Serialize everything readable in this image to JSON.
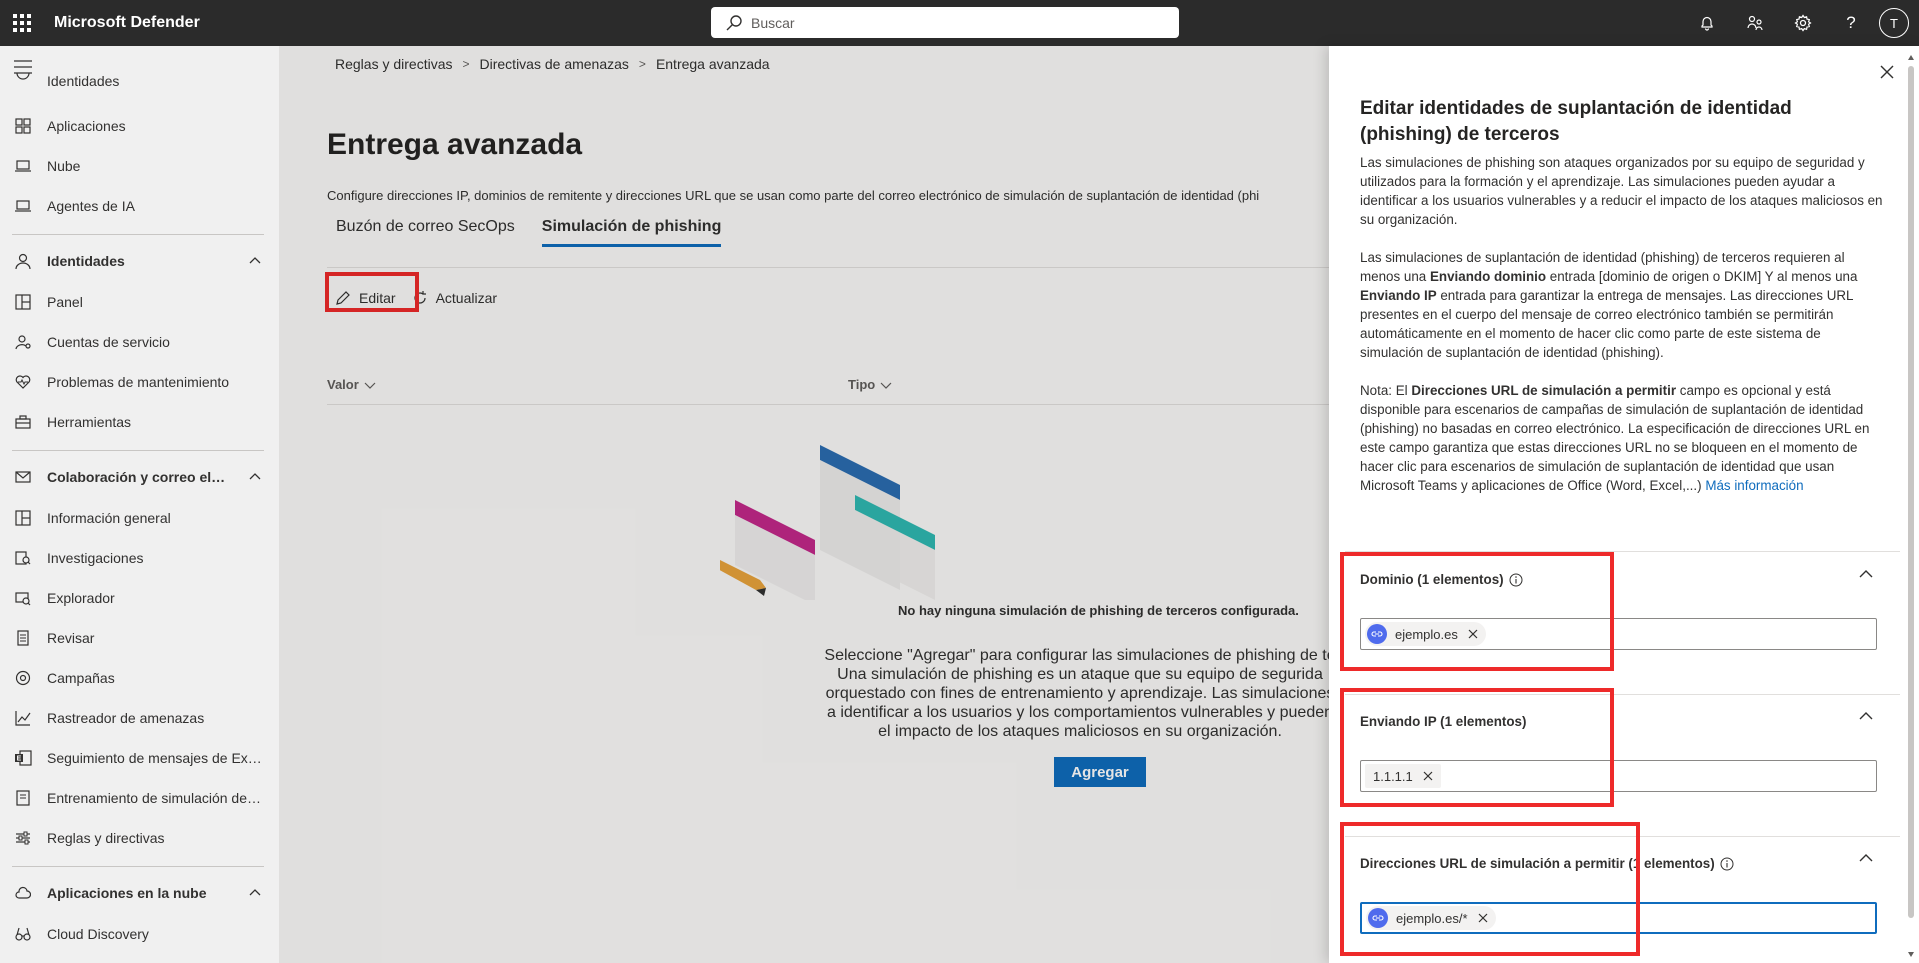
{
  "app": {
    "title": "Microsoft Defender",
    "search_placeholder": "Buscar",
    "avatar_initial": "T"
  },
  "sidebar": {
    "items": [
      {
        "label": "Identidades",
        "icon": "users-icon",
        "partial": true
      },
      {
        "label": "Aplicaciones",
        "icon": "apps-icon"
      },
      {
        "label": "Nube",
        "icon": "cloud-monitor-icon"
      },
      {
        "label": "Agentes de IA",
        "icon": "laptop-icon"
      },
      {
        "label": "Identidades",
        "icon": "person-icon",
        "section": true
      },
      {
        "label": "Panel",
        "icon": "dashboard-icon"
      },
      {
        "label": "Cuentas de servicio",
        "icon": "service-account-icon"
      },
      {
        "label": "Problemas de mantenimiento",
        "icon": "heart-pulse-icon"
      },
      {
        "label": "Herramientas",
        "icon": "toolbox-icon"
      },
      {
        "label": "Colaboración y correo electrónico",
        "icon": "mail-icon",
        "section": true
      },
      {
        "label": "Información general",
        "icon": "grid-icon"
      },
      {
        "label": "Investigaciones",
        "icon": "investigation-icon"
      },
      {
        "label": "Explorador",
        "icon": "explorer-icon"
      },
      {
        "label": "Revisar",
        "icon": "document-icon"
      },
      {
        "label": "Campañas",
        "icon": "target-icon"
      },
      {
        "label": "Rastreador de amenazas",
        "icon": "chart-icon"
      },
      {
        "label": "Seguimiento de mensajes de Exchange",
        "icon": "exchange-icon"
      },
      {
        "label": "Entrenamiento de simulación de ataques",
        "icon": "training-icon"
      },
      {
        "label": "Reglas y directivas",
        "icon": "sliders-icon"
      },
      {
        "label": "Aplicaciones en la nube",
        "icon": "cloud-icon",
        "section": true
      },
      {
        "label": "Cloud Discovery",
        "icon": "binoculars-icon"
      }
    ]
  },
  "breadcrumb": [
    "Reglas y directivas",
    "Directivas de amenazas",
    "Entrega avanzada"
  ],
  "page": {
    "title": "Entrega avanzada",
    "description": "Configure direcciones IP, dominios de remitente y direcciones URL que se usan como parte del correo electrónico de simulación de suplantación de identidad (phi",
    "tabs": [
      {
        "label": "Buzón de correo SecOps",
        "active": false
      },
      {
        "label": "Simulación de phishing",
        "active": true
      }
    ],
    "commands": {
      "edit": "Editar",
      "refresh": "Actualizar"
    },
    "columns": [
      "Valor",
      "Tipo"
    ],
    "empty_title": "No hay ninguna simulación de phishing de terceros configurada.",
    "empty_text": "Seleccione \"Agregar\" para configurar las simulaciones de phishing de te Una simulación de phishing es un ataque que su equipo de segurida orquestado con fines de entrenamiento y aprendizaje. Las simulaciones a identificar a los usuarios y los comportamientos vulnerables y pueden el impacto de los ataques maliciosos en su organización.",
    "add_button": "Agregar"
  },
  "panel": {
    "title": "Editar identidades de suplantación de identidad (phishing) de terceros",
    "p1": "Las simulaciones de phishing son ataques organizados por su equipo de seguridad y utilizados para la formación y el aprendizaje. Las simulaciones pueden ayudar a identificar a los usuarios vulnerables y a reducir el impacto de los ataques maliciosos en su organización.",
    "p2_a": "Las simulaciones de suplantación de identidad (phishing) de terceros requieren al menos una ",
    "p2_b": "Enviando dominio",
    "p2_c": " entrada [dominio de origen o DKIM] Y al menos una ",
    "p2_d": "Enviando IP",
    "p2_e": " entrada para garantizar la entrega de mensajes. Las direcciones URL presentes en el cuerpo del mensaje de correo electrónico también se permitirán automáticamente en el momento de hacer clic como parte de este sistema de simulación de suplantación de identidad (phishing).",
    "p3_a": "Nota: El ",
    "p3_b": "Direcciones URL de simulación a permitir",
    "p3_c": " campo es opcional y está disponible para escenarios de campañas de simulación de suplantación de identidad (phishing) no basadas en correo electrónico. La especificación de direcciones URL en este campo garantiza que estas direcciones URL no se bloqueen en el momento de hacer clic para escenarios de simulación de suplantación de identidad que usan Microsoft Teams y aplicaciones de Office (Word, Excel,...) ",
    "p3_link": "Más información",
    "domain_label": "Dominio (1 elementos)",
    "domain_tag": "ejemplo.es",
    "ip_label": "Enviando IP (1 elementos)",
    "ip_tag": "1.1.1.1",
    "url_label": "Direcciones URL de simulación a permitir (1 elementos)",
    "url_tag": "ejemplo.es/*"
  },
  "colors": {
    "accent": "#0f6cbd",
    "highlight": "#ee2a2a",
    "topbar": "#2b2b2b",
    "tag_icon": "#4f6bed"
  }
}
